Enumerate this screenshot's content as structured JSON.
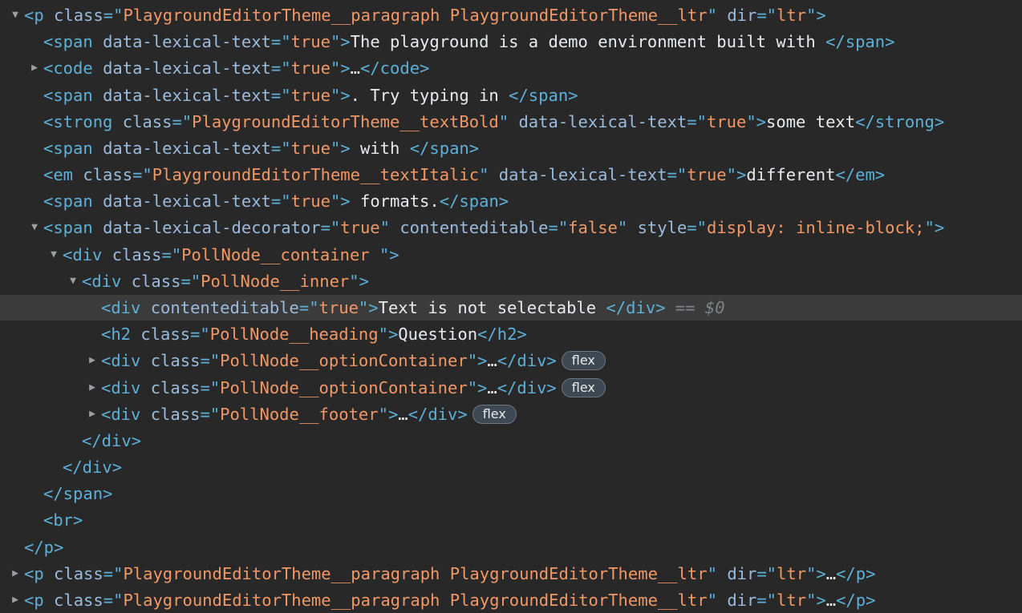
{
  "panel": "Elements",
  "nodes": [
    {
      "depth": 0,
      "toggle": "expanded",
      "parts": [
        [
          "tag",
          "<p "
        ],
        [
          "attr",
          "class"
        ],
        [
          "tag",
          "=\""
        ],
        [
          "val",
          "PlaygroundEditorTheme__paragraph PlaygroundEditorTheme__ltr"
        ],
        [
          "tag",
          "\" "
        ],
        [
          "attr",
          "dir"
        ],
        [
          "tag",
          "=\""
        ],
        [
          "val",
          "ltr"
        ],
        [
          "tag",
          "\">"
        ]
      ]
    },
    {
      "depth": 1,
      "toggle": "none",
      "parts": [
        [
          "tag",
          "<span "
        ],
        [
          "attr",
          "data-lexical-text"
        ],
        [
          "tag",
          "=\""
        ],
        [
          "val",
          "true"
        ],
        [
          "tag",
          "\">"
        ],
        [
          "text",
          "The playground is a demo environment built with "
        ],
        [
          "tag",
          "</span>"
        ]
      ]
    },
    {
      "depth": 1,
      "toggle": "collapsed",
      "parts": [
        [
          "tag",
          "<code "
        ],
        [
          "attr",
          "data-lexical-text"
        ],
        [
          "tag",
          "=\""
        ],
        [
          "val",
          "true"
        ],
        [
          "tag",
          "\">"
        ],
        [
          "text",
          "…"
        ],
        [
          "tag",
          "</code>"
        ]
      ]
    },
    {
      "depth": 1,
      "toggle": "none",
      "parts": [
        [
          "tag",
          "<span "
        ],
        [
          "attr",
          "data-lexical-text"
        ],
        [
          "tag",
          "=\""
        ],
        [
          "val",
          "true"
        ],
        [
          "tag",
          "\">"
        ],
        [
          "text",
          ". Try typing in "
        ],
        [
          "tag",
          "</span>"
        ]
      ]
    },
    {
      "depth": 1,
      "toggle": "none",
      "parts": [
        [
          "tag",
          "<strong "
        ],
        [
          "attr",
          "class"
        ],
        [
          "tag",
          "=\""
        ],
        [
          "val",
          "PlaygroundEditorTheme__textBold"
        ],
        [
          "tag",
          "\" "
        ],
        [
          "attr",
          "data-lexical-text"
        ],
        [
          "tag",
          "=\""
        ],
        [
          "val",
          "true"
        ],
        [
          "tag",
          "\">"
        ],
        [
          "text",
          "some text"
        ],
        [
          "tag",
          "</strong>"
        ]
      ]
    },
    {
      "depth": 1,
      "toggle": "none",
      "parts": [
        [
          "tag",
          "<span "
        ],
        [
          "attr",
          "data-lexical-text"
        ],
        [
          "tag",
          "=\""
        ],
        [
          "val",
          "true"
        ],
        [
          "tag",
          "\">"
        ],
        [
          "text",
          " with "
        ],
        [
          "tag",
          "</span>"
        ]
      ]
    },
    {
      "depth": 1,
      "toggle": "none",
      "parts": [
        [
          "tag",
          "<em "
        ],
        [
          "attr",
          "class"
        ],
        [
          "tag",
          "=\""
        ],
        [
          "val",
          "PlaygroundEditorTheme__textItalic"
        ],
        [
          "tag",
          "\" "
        ],
        [
          "attr",
          "data-lexical-text"
        ],
        [
          "tag",
          "=\""
        ],
        [
          "val",
          "true"
        ],
        [
          "tag",
          "\">"
        ],
        [
          "text",
          "different"
        ],
        [
          "tag",
          "</em>"
        ]
      ]
    },
    {
      "depth": 1,
      "toggle": "none",
      "parts": [
        [
          "tag",
          "<span "
        ],
        [
          "attr",
          "data-lexical-text"
        ],
        [
          "tag",
          "=\""
        ],
        [
          "val",
          "true"
        ],
        [
          "tag",
          "\">"
        ],
        [
          "text",
          " formats."
        ],
        [
          "tag",
          "</span>"
        ]
      ]
    },
    {
      "depth": 1,
      "toggle": "expanded",
      "parts": [
        [
          "tag",
          "<span "
        ],
        [
          "attr",
          "data-lexical-decorator"
        ],
        [
          "tag",
          "=\""
        ],
        [
          "val",
          "true"
        ],
        [
          "tag",
          "\" "
        ],
        [
          "attr",
          "contenteditable"
        ],
        [
          "tag",
          "=\""
        ],
        [
          "val",
          "false"
        ],
        [
          "tag",
          "\" "
        ],
        [
          "attr",
          "style"
        ],
        [
          "tag",
          "=\""
        ],
        [
          "val",
          "display: inline-block;"
        ],
        [
          "tag",
          "\">"
        ]
      ]
    },
    {
      "depth": 2,
      "toggle": "expanded",
      "parts": [
        [
          "tag",
          "<div "
        ],
        [
          "attr",
          "class"
        ],
        [
          "tag",
          "=\""
        ],
        [
          "val",
          "PollNode__container "
        ],
        [
          "tag",
          "\">"
        ]
      ]
    },
    {
      "depth": 3,
      "toggle": "expanded",
      "parts": [
        [
          "tag",
          "<div "
        ],
        [
          "attr",
          "class"
        ],
        [
          "tag",
          "=\""
        ],
        [
          "val",
          "PollNode__inner"
        ],
        [
          "tag",
          "\">"
        ]
      ]
    },
    {
      "depth": 4,
      "toggle": "none",
      "selected": true,
      "parts": [
        [
          "tag",
          "<div "
        ],
        [
          "attr",
          "contenteditable"
        ],
        [
          "tag",
          "=\""
        ],
        [
          "val",
          "true"
        ],
        [
          "tag",
          "\">"
        ],
        [
          "text",
          "Text is not selectable "
        ],
        [
          "tag",
          "</div>"
        ],
        [
          "dim",
          " == "
        ],
        [
          "dollar",
          "$0"
        ]
      ]
    },
    {
      "depth": 4,
      "toggle": "none",
      "parts": [
        [
          "tag",
          "<h2 "
        ],
        [
          "attr",
          "class"
        ],
        [
          "tag",
          "=\""
        ],
        [
          "val",
          "PollNode__heading"
        ],
        [
          "tag",
          "\">"
        ],
        [
          "text",
          "Question"
        ],
        [
          "tag",
          "</h2>"
        ]
      ]
    },
    {
      "depth": 4,
      "toggle": "collapsed",
      "badge": "flex",
      "parts": [
        [
          "tag",
          "<div "
        ],
        [
          "attr",
          "class"
        ],
        [
          "tag",
          "=\""
        ],
        [
          "val",
          "PollNode__optionContainer"
        ],
        [
          "tag",
          "\">"
        ],
        [
          "text",
          "…"
        ],
        [
          "tag",
          "</div>"
        ]
      ]
    },
    {
      "depth": 4,
      "toggle": "collapsed",
      "badge": "flex",
      "parts": [
        [
          "tag",
          "<div "
        ],
        [
          "attr",
          "class"
        ],
        [
          "tag",
          "=\""
        ],
        [
          "val",
          "PollNode__optionContainer"
        ],
        [
          "tag",
          "\">"
        ],
        [
          "text",
          "…"
        ],
        [
          "tag",
          "</div>"
        ]
      ]
    },
    {
      "depth": 4,
      "toggle": "collapsed",
      "badge": "flex",
      "parts": [
        [
          "tag",
          "<div "
        ],
        [
          "attr",
          "class"
        ],
        [
          "tag",
          "=\""
        ],
        [
          "val",
          "PollNode__footer"
        ],
        [
          "tag",
          "\">"
        ],
        [
          "text",
          "…"
        ],
        [
          "tag",
          "</div>"
        ]
      ]
    },
    {
      "depth": 3,
      "toggle": "none",
      "parts": [
        [
          "tag",
          "</div>"
        ]
      ]
    },
    {
      "depth": 2,
      "toggle": "none",
      "parts": [
        [
          "tag",
          "</div>"
        ]
      ]
    },
    {
      "depth": 1,
      "toggle": "none",
      "parts": [
        [
          "tag",
          "</span>"
        ]
      ]
    },
    {
      "depth": 1,
      "toggle": "none",
      "parts": [
        [
          "tag",
          "<br>"
        ]
      ]
    },
    {
      "depth": 0,
      "toggle": "none",
      "parts": [
        [
          "tag",
          "</p>"
        ]
      ]
    },
    {
      "depth": 0,
      "toggle": "collapsed",
      "parts": [
        [
          "tag",
          "<p "
        ],
        [
          "attr",
          "class"
        ],
        [
          "tag",
          "=\""
        ],
        [
          "val",
          "PlaygroundEditorTheme__paragraph PlaygroundEditorTheme__ltr"
        ],
        [
          "tag",
          "\" "
        ],
        [
          "attr",
          "dir"
        ],
        [
          "tag",
          "=\""
        ],
        [
          "val",
          "ltr"
        ],
        [
          "tag",
          "\">"
        ],
        [
          "text",
          "…"
        ],
        [
          "tag",
          "</p>"
        ]
      ]
    },
    {
      "depth": 0,
      "toggle": "collapsed",
      "parts": [
        [
          "tag",
          "<p "
        ],
        [
          "attr",
          "class"
        ],
        [
          "tag",
          "=\""
        ],
        [
          "val",
          "PlaygroundEditorTheme__paragraph PlaygroundEditorTheme__ltr"
        ],
        [
          "tag",
          "\" "
        ],
        [
          "attr",
          "dir"
        ],
        [
          "tag",
          "=\""
        ],
        [
          "val",
          "ltr"
        ],
        [
          "tag",
          "\">"
        ],
        [
          "text",
          "…"
        ],
        [
          "tag",
          "</p>"
        ]
      ]
    }
  ],
  "glyphs": {
    "expanded": "▼",
    "collapsed": "▶"
  },
  "colors": {
    "tag": "#5db0d7",
    "attr": "#9bbbdc",
    "value": "#f29766",
    "text": "#e8eaed",
    "background": "#282828",
    "selected_row": "#3b3b3b"
  }
}
